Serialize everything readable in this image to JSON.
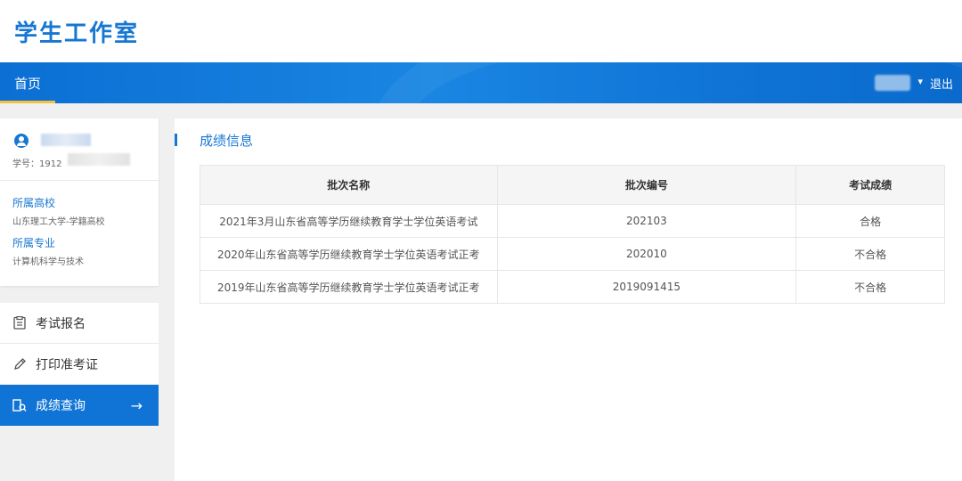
{
  "header": {
    "title": "学生工作室"
  },
  "nav": {
    "home": "首页",
    "logout": "退出",
    "caret": "▾"
  },
  "profile": {
    "sid_label": "学号：1912",
    "school_label": "所属高校",
    "school_value": "山东理工大学-学籍高校",
    "major_label": "所属专业",
    "major_value": "计算机科学与技术"
  },
  "menu": {
    "items": [
      {
        "label": "考试报名",
        "icon": "document-icon"
      },
      {
        "label": "打印准考证",
        "icon": "pencil-icon"
      },
      {
        "label": "成绩查询",
        "icon": "search-icon",
        "active": true
      }
    ],
    "arrow": "→"
  },
  "main": {
    "section_title": "成绩信息",
    "table": {
      "headers": [
        "批次名称",
        "批次编号",
        "考试成绩"
      ],
      "rows": [
        [
          "2021年3月山东省高等学历继续教育学士学位英语考试",
          "202103",
          "合格"
        ],
        [
          "2020年山东省高等学历继续教育学士学位英语考试正考",
          "202010",
          "不合格"
        ],
        [
          "2019年山东省高等学历继续教育学士学位英语考试正考",
          "2019091415",
          "不合格"
        ]
      ]
    }
  },
  "colors": {
    "accent": "#1677d2",
    "nav_active_underline": "#f7c03a",
    "active_menu_bg": "#0f74d6"
  }
}
